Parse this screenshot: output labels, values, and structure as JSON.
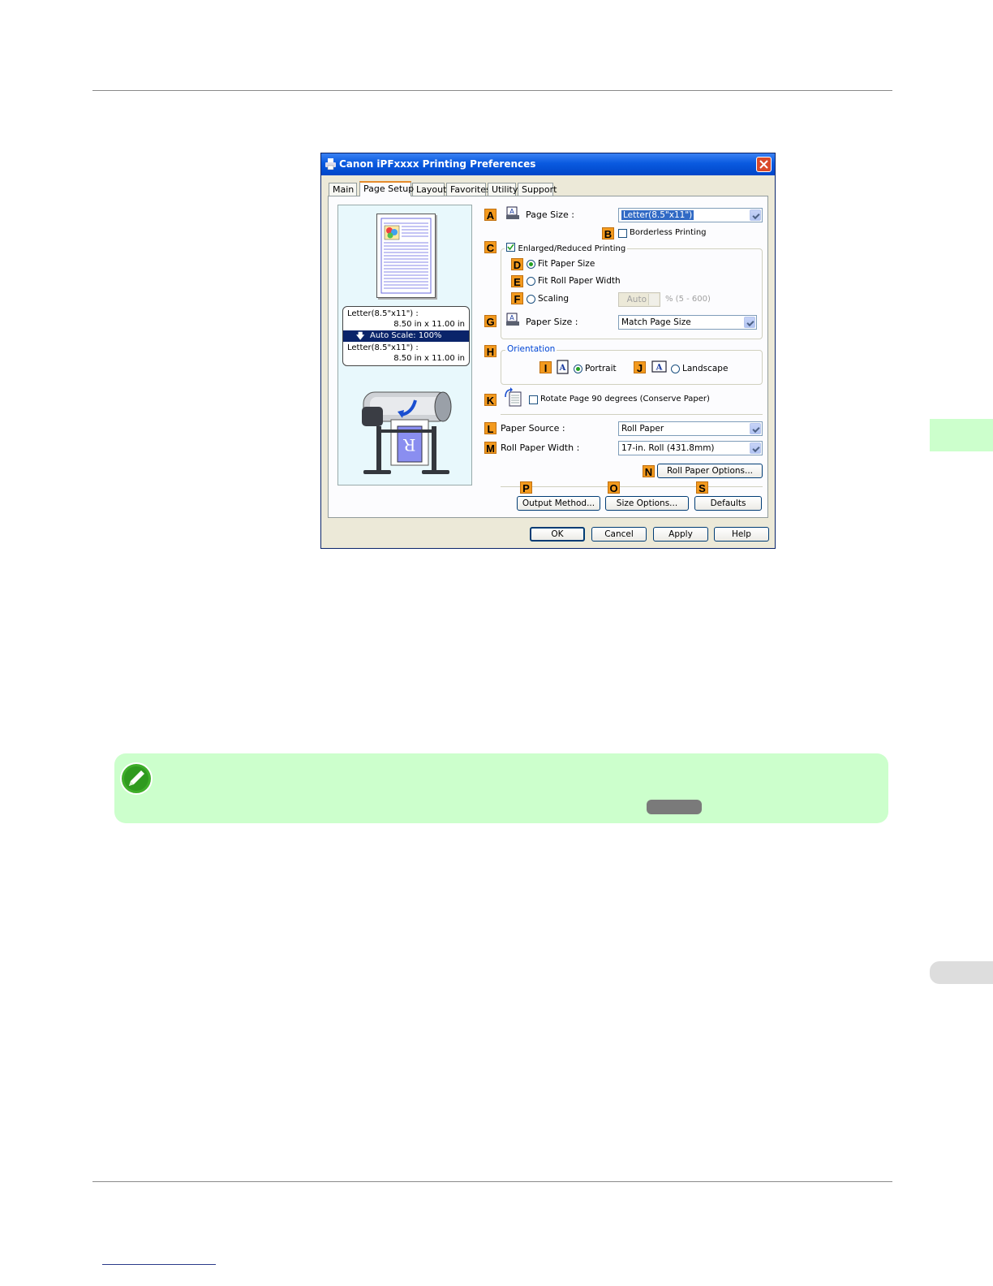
{
  "dialog": {
    "title": "Canon iPFxxxx Printing Preferences",
    "tabs": [
      "Main",
      "Page Setup",
      "Layout",
      "Favorites",
      "Utility",
      "Support"
    ],
    "active_tab": "Page Setup",
    "preview": {
      "source_size": "Letter(8.5\"x11\") :",
      "source_dims": "8.50 in x 11.00 in",
      "scale": "Auto Scale: 100%",
      "output_size": "Letter(8.5\"x11\") :",
      "output_dims": "8.50 in x 11.00 in"
    },
    "labels": {
      "A": "A",
      "B": "B",
      "C": "C",
      "D": "D",
      "E": "E",
      "F": "F",
      "G": "G",
      "H": "H",
      "I": "I",
      "J": "J",
      "K": "K",
      "L": "L",
      "M": "M",
      "N": "N",
      "P": "P",
      "O": "O",
      "S": "S"
    },
    "page_size_label": "Page Size :",
    "page_size_value": "Letter(8.5\"x11\")",
    "borderless_label": "Borderless Printing",
    "borderless_checked": false,
    "enlarged_label": "Enlarged/Reduced Printing",
    "enlarged_checked": true,
    "fit_paper_size": "Fit Paper Size",
    "fit_roll_width": "Fit Roll Paper Width",
    "scaling": "Scaling",
    "scaling_value": "Auto",
    "scaling_range": "% (5 - 600)",
    "selected_scaling_option": "Fit Paper Size",
    "paper_size_label": "Paper Size :",
    "paper_size_value": "Match Page Size",
    "orientation_label": "Orientation",
    "portrait": "Portrait",
    "landscape": "Landscape",
    "selected_orientation": "Portrait",
    "rotate_label": "Rotate Page 90 degrees (Conserve Paper)",
    "rotate_checked": false,
    "paper_source_label": "Paper Source :",
    "paper_source_value": "Roll Paper",
    "roll_width_label": "Roll Paper Width :",
    "roll_width_value": "17-in. Roll (431.8mm)",
    "buttons": {
      "roll_options": "Roll Paper Options...",
      "output_method": "Output Method...",
      "size_options": "Size Options...",
      "defaults": "Defaults",
      "ok": "OK",
      "cancel": "Cancel",
      "apply": "Apply",
      "help": "Help"
    },
    "colors": {
      "badge": "#f39a1e",
      "titlebar": "#0a5ae0",
      "note_bg": "#ccffcc"
    }
  },
  "icons": [
    "printer-title-icon",
    "close-icon",
    "page-size-icon",
    "paper-size-icon",
    "portrait-icon",
    "landscape-icon",
    "rotate-icon",
    "note-pencil-icon",
    "printer-illustration"
  ]
}
